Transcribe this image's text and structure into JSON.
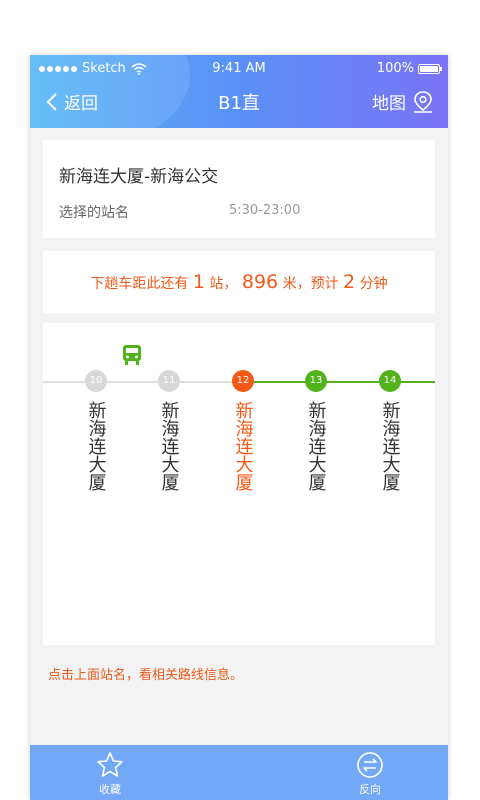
{
  "status": {
    "carrier": "Sketch",
    "time": "9:41 AM",
    "battery": "100%"
  },
  "nav": {
    "back_label": "返回",
    "title": "B1直",
    "map_label": "地图"
  },
  "route": {
    "name": "新海连大厦-新海公交",
    "selected_label": "选择的站名",
    "hours": "5:30-23:00"
  },
  "info": {
    "prefix": "下趟车距此还有",
    "stops_count": "1",
    "stops_unit": "站，",
    "distance": "896",
    "distance_unit": "米，预计",
    "minutes": "2",
    "minutes_unit": "分钟"
  },
  "stops": [
    {
      "number": "10",
      "name": "新海连大厦",
      "state": "passed"
    },
    {
      "number": "11",
      "name": "新海连大厦",
      "state": "passed"
    },
    {
      "number": "12",
      "name": "新海连大厦",
      "state": "current"
    },
    {
      "number": "13",
      "name": "新海连大厦",
      "state": "ahead"
    },
    {
      "number": "14",
      "name": "新海连大厦",
      "state": "ahead"
    }
  ],
  "bus_icon": "bus-icon",
  "colors": {
    "accent_orange": "#f45a16",
    "route_green": "#52b21c",
    "passed_grey": "#d8d8d8",
    "tab_blue": "#72a8f6"
  },
  "hint": "点击上面站名，看相关路线信息。",
  "tabs": {
    "favorite_label": "收藏",
    "reverse_label": "反向"
  }
}
